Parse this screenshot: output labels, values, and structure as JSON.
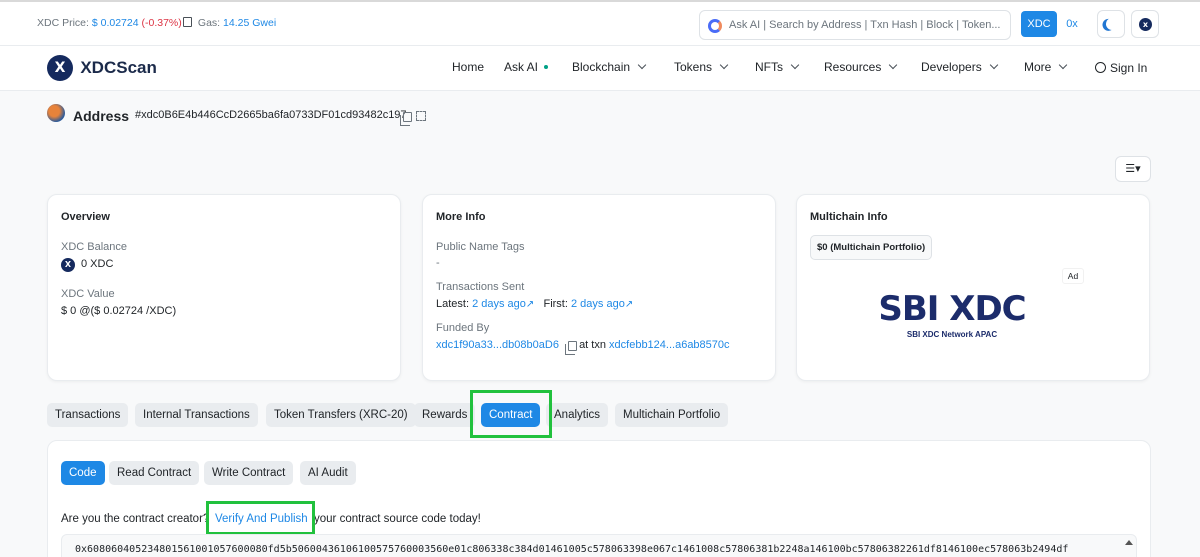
{
  "topbar": {
    "price_label": "XDC Price:",
    "price_value": "$ 0.02724",
    "price_change": "(-0.37%)",
    "gas_label": "Gas:",
    "gas_value": "14.25 Gwei",
    "search_placeholder": "Ask AI | Search by Address | Txn Hash | Block | Token...",
    "currency_xdc": "XDC",
    "currency_0x": "0x",
    "network_icon_letter": "x"
  },
  "nav": {
    "brand": "XDCScan",
    "brand_icon_letter": "X",
    "items": [
      "Home",
      "Ask AI",
      "Blockchain",
      "Tokens",
      "NFTs",
      "Resources",
      "Developers",
      "More"
    ],
    "sign_in": "Sign In"
  },
  "address": {
    "title": "Address",
    "hash": "#xdc0B6E4b446CcD2665ba6fa0733DF01cd93482c197",
    "view_button": "☰▾"
  },
  "overview": {
    "title": "Overview",
    "balance_label": "XDC Balance",
    "balance_value": "0 XDC",
    "value_label": "XDC Value",
    "value_value": "$ 0  @($ 0.02724 /XDC)"
  },
  "more_info": {
    "title": "More Info",
    "tags_label": "Public Name Tags",
    "tags_value": "-",
    "sent_label": "Transactions Sent",
    "latest_label": "Latest:",
    "latest_value": "2 days ago",
    "first_label": "First:",
    "first_value": "2 days ago",
    "funded_label": "Funded By",
    "funded_addr": "xdc1f90a33...db08b0aD6",
    "at_txn": "at txn",
    "funded_txn": "xdcfebb124...a6ab8570c"
  },
  "multichain": {
    "title": "Multichain Info",
    "portfolio": "$0 (Multichain Portfolio)",
    "ad_label": "Ad",
    "banner_text": "SBI XDC",
    "banner_sub": "SBI XDC Network APAC"
  },
  "tabs": [
    "Transactions",
    "Internal Transactions",
    "Token Transfers (XRC-20)",
    "Rewards",
    "Contract",
    "Analytics",
    "Multichain Portfolio"
  ],
  "contract": {
    "subtabs": [
      "Code",
      "Read Contract",
      "Write Contract",
      "AI Audit"
    ],
    "creator_prefix": "Are you the contract creator?",
    "verify_link": "Verify And Publish",
    "creator_suffix": "your contract source code today!",
    "bytecode": "0x608060405234801561001057600080fd5b50600436106100575760003560e01c806338c384d01461005c578063398e067c1461008c57806381b2248a146100bc57806382261df8146100ec578063b2494df"
  },
  "colors": {
    "accent": "#1e88e5",
    "highlight": "#21c13d",
    "negative": "#dc3545"
  }
}
